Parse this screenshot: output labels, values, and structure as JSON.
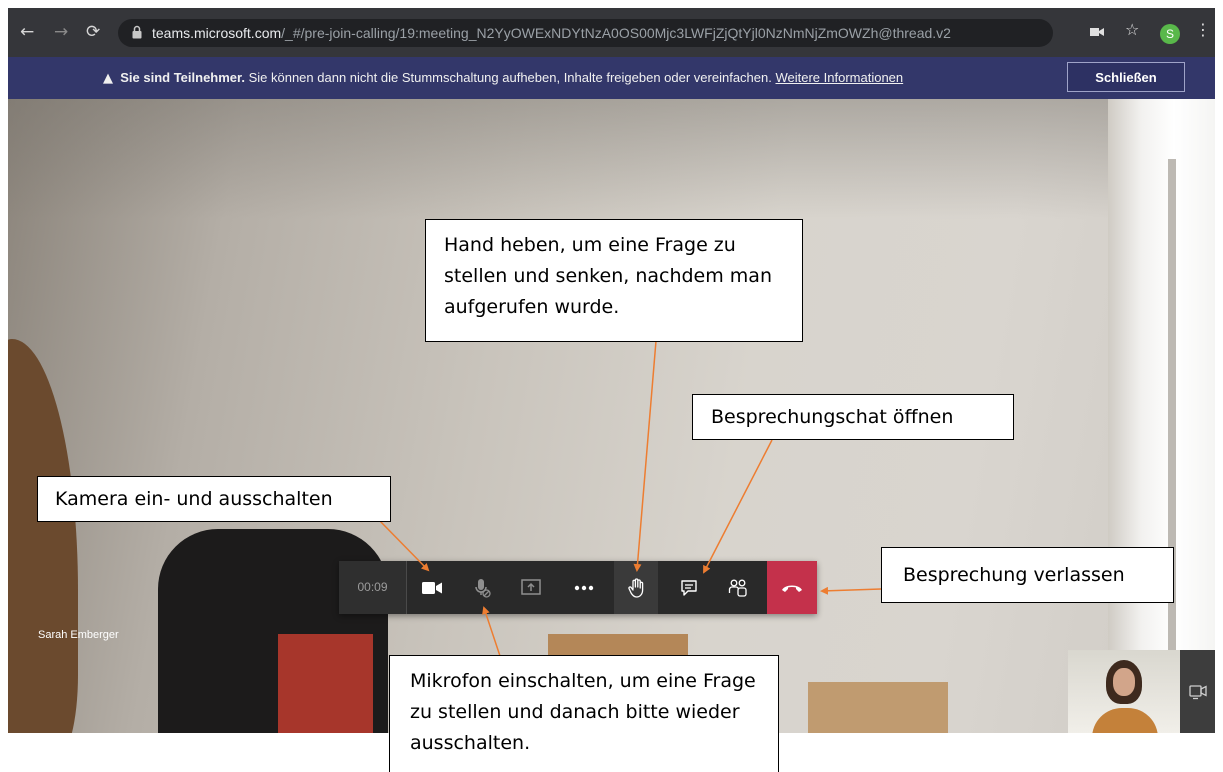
{
  "browser": {
    "url_host": "teams.microsoft.com",
    "url_path": "/_#/pre-join-calling/19:meeting_N2YyOWExNDYtNzA0OS00Mjc3LWFjZjQtYjl0NzNmNjZmOWZh@thread.v2",
    "profile_initial": "S",
    "icons": [
      "back-arrow-icon",
      "forward-arrow-icon",
      "reload-icon",
      "lock-icon",
      "camera-icon",
      "star-icon",
      "menu-dots-icon"
    ]
  },
  "notice": {
    "bold": "Sie sind Teilnehmer.",
    "text": " Sie können dann nicht die Stummschaltung aufheben, Inhalte freigeben oder vereinfachen.",
    "link": "Weitere Informationen",
    "close_label": "Schließen"
  },
  "call": {
    "timer": "00:09",
    "participant_name": "Sarah Emberger",
    "controls": [
      "camera-icon",
      "microphone-muted-icon",
      "share-screen-icon",
      "more-options-icon",
      "raise-hand-icon",
      "chat-icon",
      "participants-icon",
      "hang-up-icon"
    ]
  },
  "callouts": {
    "hand": "Hand heben, um eine Frage zu stellen und senken, nachdem man aufgerufen wurde.",
    "chat": "Besprechungschat öffnen",
    "camera": "Kamera ein- und ausschalten",
    "leave": "Besprechung verlassen",
    "mic": "Mikrofon einschalten, um eine Frage zu stellen und danach bitte wieder ausschalten."
  },
  "colors": {
    "notice_bg": "#33376a",
    "hangup_red": "#c4314b",
    "arrow_orange": "#ed7d31",
    "browser_bg": "#35363a"
  }
}
